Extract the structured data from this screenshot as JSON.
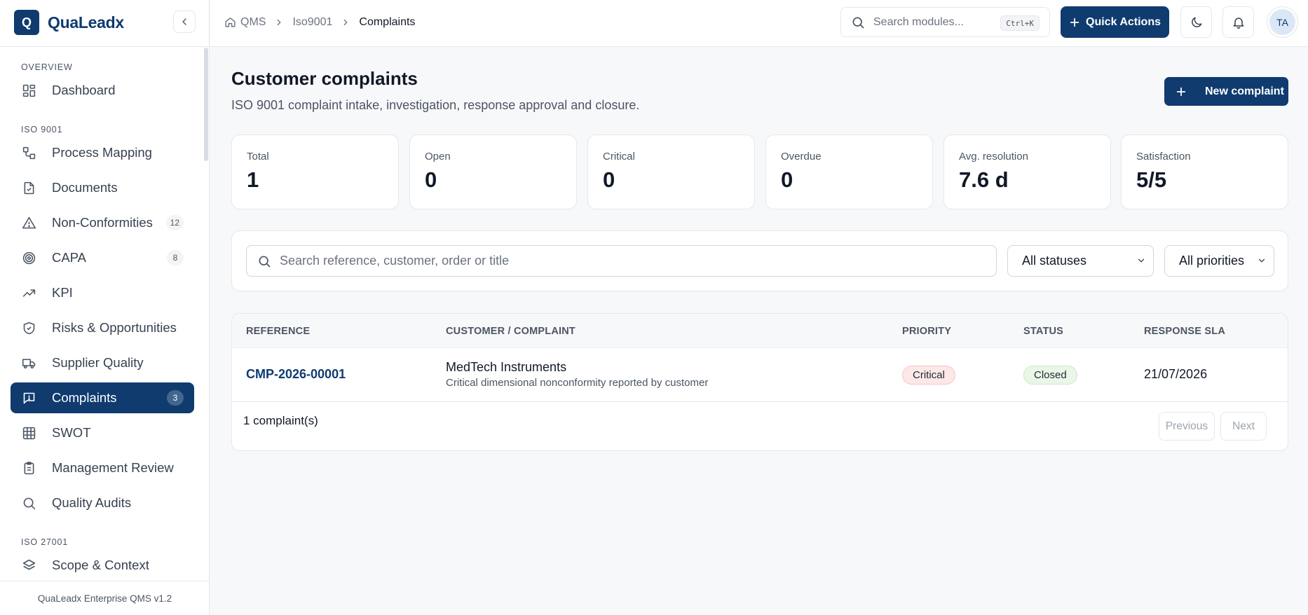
{
  "brand": {
    "logo_letter": "Q",
    "name": "QuaLeadx"
  },
  "sidebar": {
    "sections": [
      {
        "title": "OVERVIEW"
      },
      {
        "title": "ISO 9001"
      },
      {
        "title": "ISO 27001"
      }
    ],
    "items": [
      {
        "label": "Dashboard",
        "icon": "dashboard-icon"
      },
      {
        "label": "Process Mapping",
        "icon": "process-icon"
      },
      {
        "label": "Documents",
        "icon": "document-icon"
      },
      {
        "label": "Non-Conformities",
        "icon": "warning-icon",
        "badge": "12"
      },
      {
        "label": "CAPA",
        "icon": "target-icon",
        "badge": "8"
      },
      {
        "label": "KPI",
        "icon": "trending-up-icon"
      },
      {
        "label": "Risks & Opportunities",
        "icon": "shield-icon"
      },
      {
        "label": "Supplier Quality",
        "icon": "truck-icon"
      },
      {
        "label": "Complaints",
        "icon": "message-alert-icon",
        "badge": "3",
        "active": true
      },
      {
        "label": "SWOT",
        "icon": "grid-icon"
      },
      {
        "label": "Management Review",
        "icon": "clipboard-icon"
      },
      {
        "label": "Quality Audits",
        "icon": "search-icon"
      },
      {
        "label": "Scope & Context",
        "icon": "layers-icon"
      }
    ],
    "footer": "QuaLeadx Enterprise QMS v1.2"
  },
  "topbar": {
    "breadcrumb": [
      "QMS",
      "Iso9001",
      "Complaints"
    ],
    "search_placeholder": "Search modules...",
    "shortcut": "Ctrl+K",
    "quick_actions": "Quick Actions",
    "avatar_initials": "TA"
  },
  "page": {
    "title": "Customer complaints",
    "subtitle": "ISO 9001 complaint intake, investigation, response approval and closure.",
    "new_button": "New complaint"
  },
  "stats": [
    {
      "label": "Total",
      "value": "1"
    },
    {
      "label": "Open",
      "value": "0"
    },
    {
      "label": "Critical",
      "value": "0"
    },
    {
      "label": "Overdue",
      "value": "0"
    },
    {
      "label": "Avg. resolution",
      "value": "7.6 d"
    },
    {
      "label": "Satisfaction",
      "value": "5/5"
    }
  ],
  "filters": {
    "search_placeholder": "Search reference, customer, order or title",
    "status_selected": "All statuses",
    "priority_selected": "All priorities"
  },
  "table": {
    "headers": [
      "REFERENCE",
      "CUSTOMER / COMPLAINT",
      "PRIORITY",
      "STATUS",
      "RESPONSE SLA"
    ],
    "rows": [
      {
        "reference": "CMP-2026-00001",
        "customer": "MedTech Instruments",
        "description": "Critical dimensional nonconformity reported by customer",
        "priority": "Critical",
        "status": "Closed",
        "sla": "21/07/2026"
      }
    ],
    "count_text": "1 complaint(s)",
    "prev_label": "Previous",
    "next_label": "Next"
  },
  "colors": {
    "primary": "#0f3b6f",
    "critical_bg": "#fde8e8",
    "closed_bg": "#eaf6e8"
  }
}
